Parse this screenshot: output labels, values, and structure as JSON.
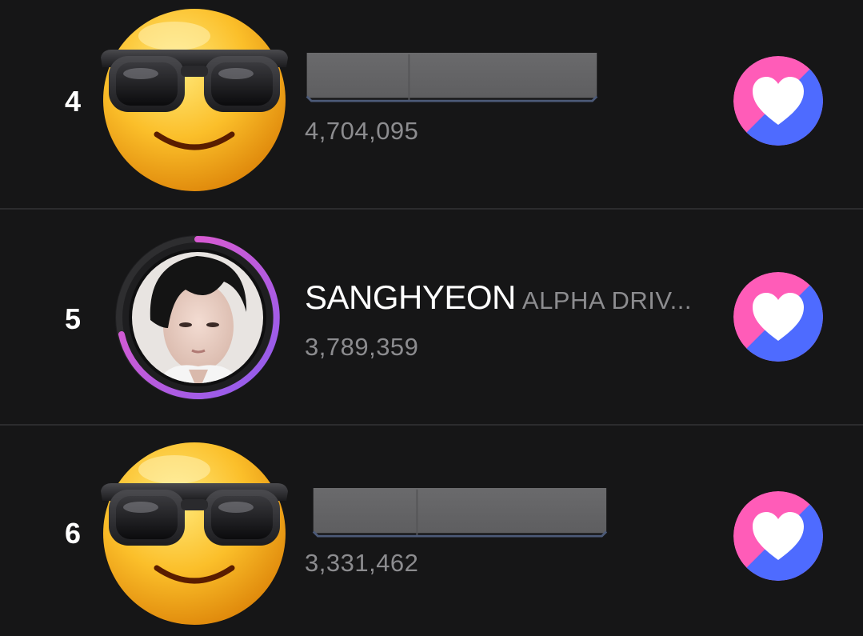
{
  "ranking": {
    "entries": [
      {
        "rank": "4",
        "avatar_icon": "smiling-face-with-sunglasses-icon",
        "name_redacted": true,
        "votes": "4,704,095",
        "vote_icon": "heart-icon"
      },
      {
        "rank": "5",
        "avatar": "profile-photo",
        "name": "SANGHYEON",
        "group": "ALPHA DRIV...",
        "votes": "3,789,359",
        "progress_ring_fraction": 0.7,
        "vote_icon": "heart-icon"
      },
      {
        "rank": "6",
        "avatar_icon": "smiling-face-with-sunglasses-icon",
        "name_redacted": true,
        "votes": "3,331,462",
        "vote_icon": "heart-icon"
      }
    ]
  },
  "colors": {
    "background": "#161617",
    "divider": "#2c2c2e",
    "vote_pink": "#ff5cb8",
    "vote_blue": "#4e6bff",
    "ring_pink": "#f05ac8",
    "ring_purple": "#8a5cf0",
    "muted_text": "#8c8c8f"
  }
}
